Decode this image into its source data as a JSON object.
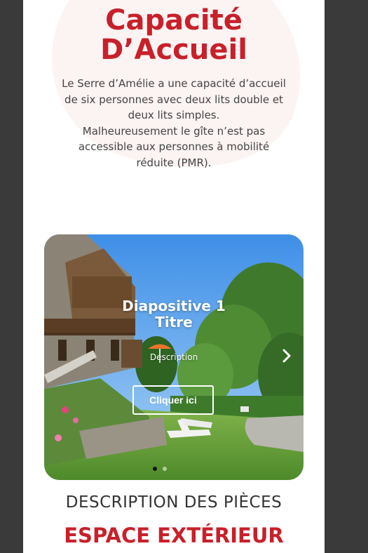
{
  "capacity_section": {
    "title_line1": "Capacité",
    "title_line2": "D’Accueil",
    "text_lines": [
      "Le Serre d’Amélie a une capacité d’accueil",
      "de six personnes avec deux lits double et",
      "deux lits simples.",
      "Malheureusement le gîte n’est pas",
      "accessible aux personnes à mobilité",
      "réduite (PMR)."
    ]
  },
  "slider": {
    "slide_title_line1": "Diapositive 1",
    "slide_title_line2": "Titre",
    "slide_description": "Description",
    "button_label": "Cliquer ici",
    "next_icon": "chevron-right-icon",
    "slide_count": 2,
    "active_slide": 1
  },
  "rooms_section": {
    "heading": "DESCRIPTION DES PIÈCES",
    "subheading": "ESPACE EXTÉRIEUR"
  },
  "colors": {
    "accent_red": "#c8202a",
    "page_bg": "#ffffff",
    "outer_bg": "#3a3a3a"
  }
}
